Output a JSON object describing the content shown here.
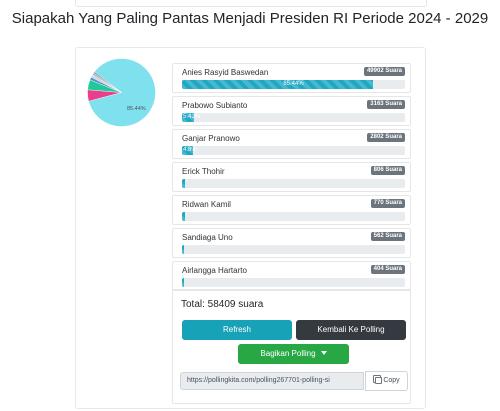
{
  "page": {
    "title": "Siapakah Yang Paling Pantas Menjadi Presiden RI Periode 2024 - 2029"
  },
  "chart_data": {
    "type": "pie",
    "slices": [
      {
        "label": "Anies Rasyid Baswedan",
        "percent": 85.44,
        "color": "#7fe0ee"
      },
      {
        "label": "Prabowo Subianto",
        "percent": 5.41,
        "color": "#e83e8c"
      },
      {
        "label": "Ganjar Pranowo",
        "percent": 4.8,
        "color": "#20c997"
      },
      {
        "label": "Erick Thohir",
        "percent": 1.38,
        "color": "#4f8fd6"
      },
      {
        "label": "Ridwan Kamil",
        "percent": 1.32,
        "color": "#ced4da"
      },
      {
        "label": "Sandiaga Uno",
        "percent": 0.96,
        "color": "#adb5bd"
      },
      {
        "label": "Airlangga Hartarto",
        "percent": 0.69,
        "color": "#868e96"
      }
    ],
    "labels_shown": [
      "85.44%"
    ]
  },
  "candidates": [
    {
      "name": "Anies Rasyid Baswedan",
      "count": "49902 Suara",
      "percent": 85.44,
      "percent_label": "85.44%"
    },
    {
      "name": "Prabowo Subianto",
      "count": "3163 Suara",
      "percent": 5.41,
      "percent_label": "5.41%"
    },
    {
      "name": "Ganjar Pranowo",
      "count": "2802 Suara",
      "percent": 4.8,
      "percent_label": "4.8%"
    },
    {
      "name": "Erick Thohir",
      "count": "806 Suara",
      "percent": 1.38,
      "percent_label": ""
    },
    {
      "name": "Ridwan Kamil",
      "count": "770 Suara",
      "percent": 1.32,
      "percent_label": ""
    },
    {
      "name": "Sandiaga Uno",
      "count": "562 Suara",
      "percent": 0.96,
      "percent_label": ""
    },
    {
      "name": "Airlangga Hartarto",
      "count": "404 Suara",
      "percent": 0.69,
      "percent_label": ""
    }
  ],
  "summary": {
    "total_label": "Total: 58409 suara",
    "refresh_label": "Refresh",
    "back_label": "Kembali Ke Polling",
    "share_label": "Bagikan Polling",
    "url_value": "https://pollingkita.com/polling267701-polling-si",
    "copy_label": "Copy"
  },
  "colors": {
    "bar": "#1fa8c4",
    "refresh": "#17a2b8",
    "back": "#343a40",
    "share": "#28a745",
    "badge": "#6c757d"
  }
}
